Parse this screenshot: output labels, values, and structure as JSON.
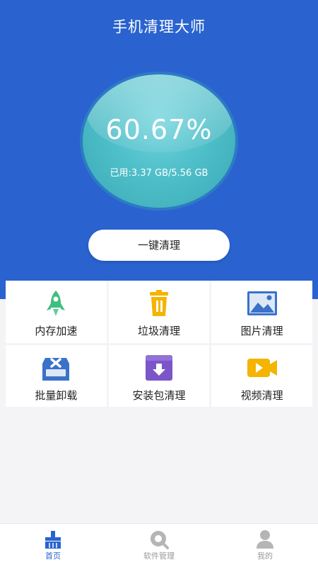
{
  "header": {
    "title": "手机清理大师"
  },
  "gauge": {
    "percent_text": "60.67%",
    "usage_text": "已用:3.37 GB/5.56 GB"
  },
  "clean_button": {
    "label": "一键清理"
  },
  "features": [
    {
      "label": "内存加速",
      "icon": "rocket-icon",
      "color": "#3fbf7f"
    },
    {
      "label": "垃圾清理",
      "icon": "trash-icon",
      "color": "#f4b400"
    },
    {
      "label": "图片清理",
      "icon": "image-icon",
      "color": "#3a72c9"
    },
    {
      "label": "批量卸载",
      "icon": "uninstall-icon",
      "color": "#3a72c9"
    },
    {
      "label": "安装包清理",
      "icon": "package-icon",
      "color": "#7b56c8"
    },
    {
      "label": "视频清理",
      "icon": "video-icon",
      "color": "#f4b400"
    }
  ],
  "tabs": [
    {
      "label": "首页",
      "icon": "home-broom-icon",
      "active": true
    },
    {
      "label": "软件管理",
      "icon": "search-icon",
      "active": false
    },
    {
      "label": "我的",
      "icon": "user-icon",
      "active": false
    }
  ],
  "colors": {
    "brand_blue": "#2a63cf",
    "gauge_teal": "#4fbfc9"
  }
}
